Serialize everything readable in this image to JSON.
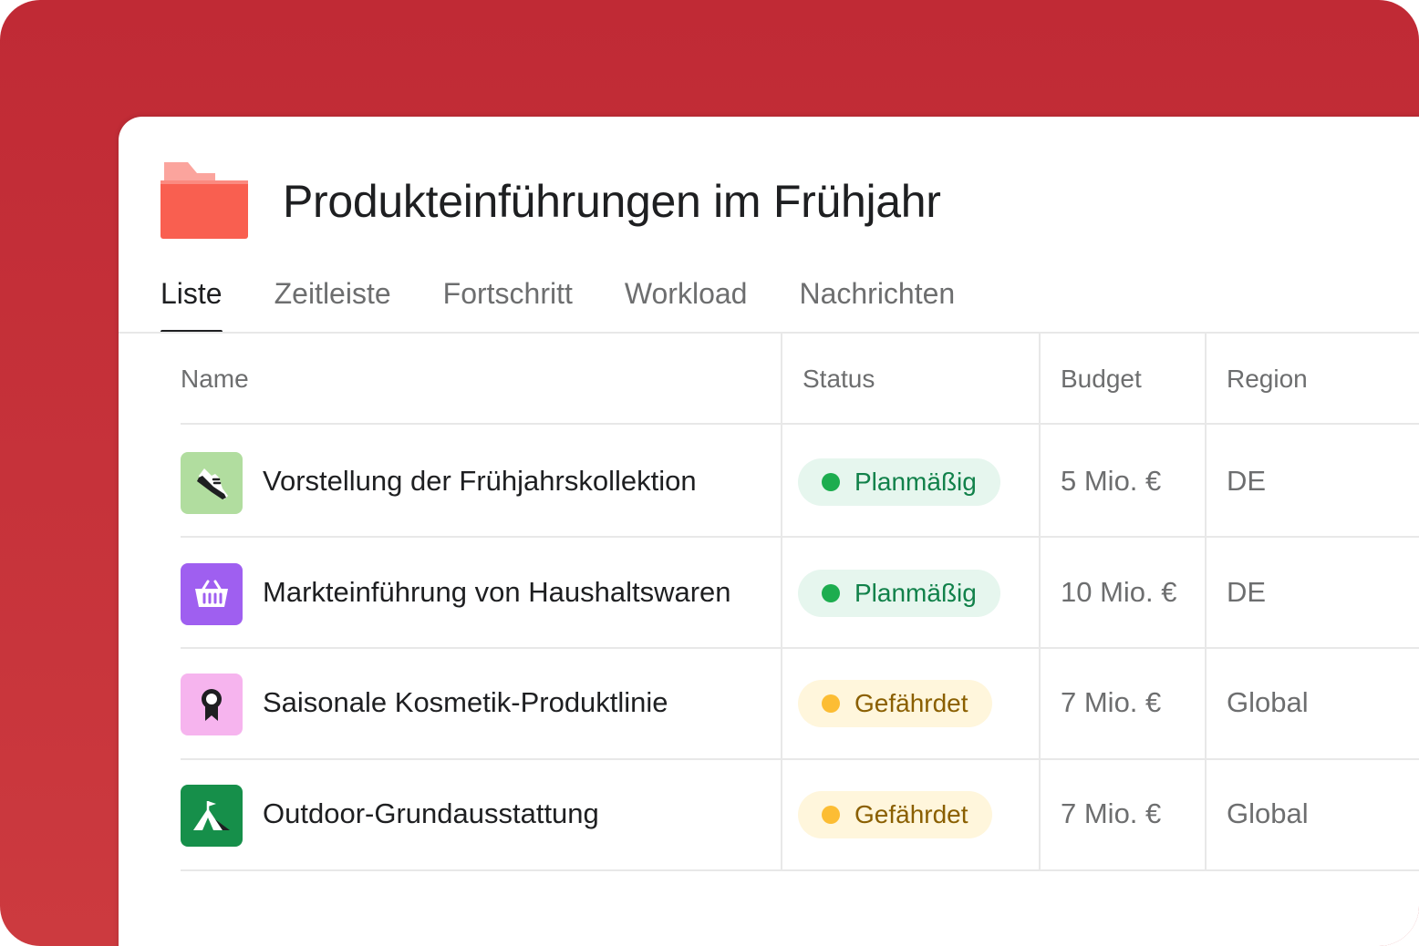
{
  "project": {
    "title": "Produkteinführungen im Frühjahr",
    "folder_icon": "folder-icon",
    "folder_color": "#f95f50"
  },
  "tabs": [
    {
      "label": "Liste",
      "active": true
    },
    {
      "label": "Zeitleiste",
      "active": false
    },
    {
      "label": "Fortschritt",
      "active": false
    },
    {
      "label": "Workload",
      "active": false
    },
    {
      "label": "Nachrichten",
      "active": false
    }
  ],
  "table": {
    "columns": [
      "Name",
      "Status",
      "Budget",
      "Region"
    ],
    "rows": [
      {
        "name": "Vorstellung der Frühjahrskollektion",
        "icon": "sneaker-icon",
        "icon_bg": "#b1dd9f",
        "status": "Planmäßig",
        "status_kind": "ok",
        "budget": "5 Mio. €",
        "region": "DE"
      },
      {
        "name": "Markteinführung von Haushaltswaren",
        "icon": "basket-icon",
        "icon_bg": "#9f5ff0",
        "status": "Planmäßig",
        "status_kind": "ok",
        "budget": "10 Mio. €",
        "region": "DE"
      },
      {
        "name": "Saisonale Kosmetik-Produktlinie",
        "icon": "ribbon-icon",
        "icon_bg": "#f6b4ee",
        "status": "Gefährdet",
        "status_kind": "risk",
        "budget": "7 Mio. €",
        "region": "Global"
      },
      {
        "name": "Outdoor-Grundausstattung",
        "icon": "tent-icon",
        "icon_bg": "#168f4a",
        "status": "Gefährdet",
        "status_kind": "risk",
        "budget": "7 Mio. €",
        "region": "Global"
      }
    ]
  },
  "status_styles": {
    "ok": {
      "bg": "#e6f6ee",
      "dot": "#1dad4f",
      "text": "#11814a"
    },
    "risk": {
      "bg": "#fff6dc",
      "dot": "#fcbd34",
      "text": "#8a5f00"
    }
  }
}
